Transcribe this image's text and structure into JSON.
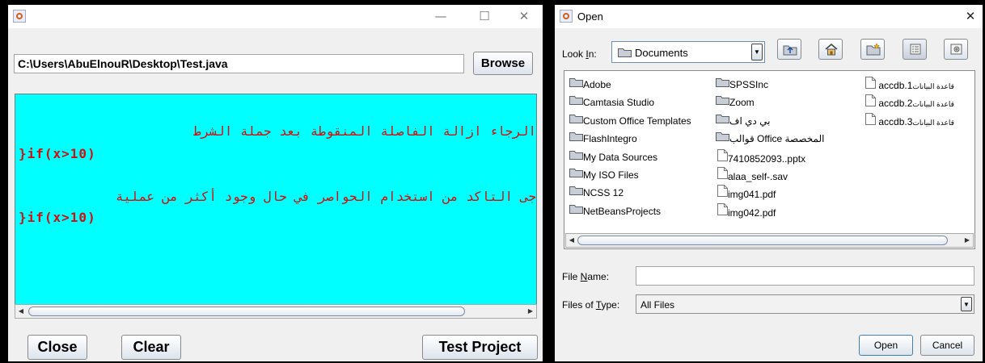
{
  "left_window": {
    "title": "",
    "controls": {
      "minimize": "—",
      "maximize": "☐",
      "close": "✕"
    },
    "path_value": "C:\\Users\\AbuElnouR\\Desktop\\Test.java",
    "browse_label": "Browse",
    "text_area": {
      "background": "#00ffff",
      "text_color": "#d01010",
      "lines": [
        "الرجاء ازالة الفاصلة المنقوطة بعد جملة الشرط",
        "}if(x>10)",
        "جى التاكد من استخدام الحواصر في حال وجود أكثر من عملية",
        "}if(x>10)"
      ]
    },
    "buttons": {
      "close": "Close",
      "clear": "Clear",
      "test_project": "Test Project"
    }
  },
  "open_dialog": {
    "title": "Open",
    "close_glyph": "✕",
    "look_in_prefix": "Look ",
    "look_in_mnemonic": "I",
    "look_in_suffix": "n:",
    "look_in_value": "Documents",
    "toolbar_icons": [
      "up-folder-icon",
      "home-icon",
      "new-folder-icon",
      "list-view-icon",
      "details-view-icon"
    ],
    "files": {
      "col1": [
        "Adobe",
        "Camtasia Studio",
        "Custom Office Templates",
        "FlashIntegro",
        "My Data Sources",
        "My ISO Files",
        "NCSS 12",
        "NetBeansProjects"
      ],
      "col2_folders": [
        "SPSSInc",
        "Zoom",
        "بي دي اف",
        "قوالب Office المخصصة"
      ],
      "col2_files": [
        "7410852093..pptx",
        "alaa_self-.sav",
        "img041.pdf",
        "img042.pdf"
      ],
      "col3_files": [
        {
          "arabic": "قاعدة البيانات",
          "latin": "accdb.1"
        },
        {
          "arabic": "قاعدة البيانات",
          "latin": "accdb.2"
        },
        {
          "arabic": "قاعدة البيانات",
          "latin": "accdb.3"
        }
      ]
    },
    "file_name_prefix": "File ",
    "file_name_mnemonic": "N",
    "file_name_suffix": "ame:",
    "file_name_value": "",
    "files_of_type_prefix": "Files of ",
    "files_of_type_mnemonic": "T",
    "files_of_type_suffix": "ype:",
    "files_of_type_value": "All Files",
    "open_label": "Open",
    "cancel_label": "Cancel",
    "accent": "#3c7fb1"
  }
}
